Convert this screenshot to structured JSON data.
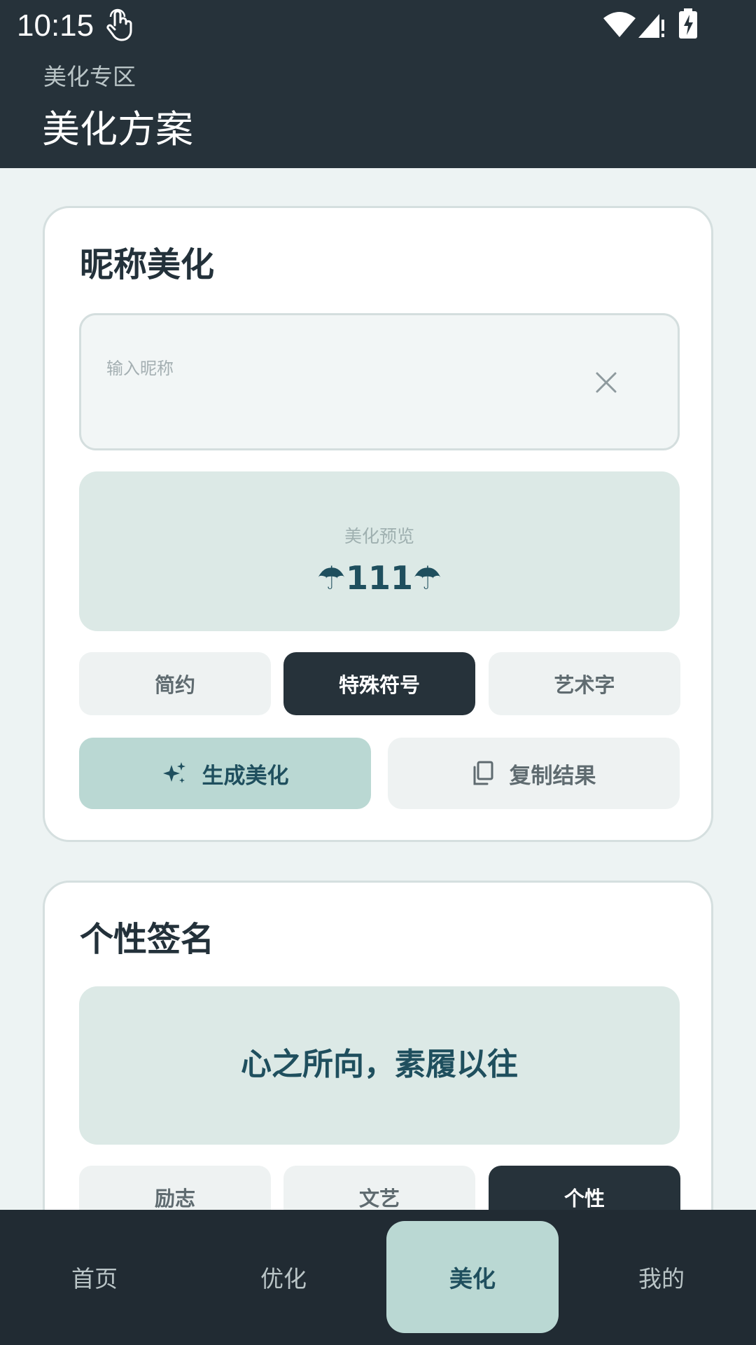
{
  "status_bar": {
    "time": "10:15",
    "icons": [
      "touch-icon",
      "wifi-icon",
      "signal-icon",
      "battery-charging-icon"
    ]
  },
  "header": {
    "subtitle": "美化专区",
    "title": "美化方案"
  },
  "nickname_card": {
    "title": "昵称美化",
    "input": {
      "placeholder": "输入昵称",
      "value": ""
    },
    "preview_label": "美化预览",
    "preview_value": "☂111☂",
    "styles": [
      {
        "label": "简约",
        "active": false
      },
      {
        "label": "特殊符号",
        "active": true
      },
      {
        "label": "艺术字",
        "active": false
      }
    ],
    "generate_label": "生成美化",
    "copy_label": "复制结果"
  },
  "signature_card": {
    "title": "个性签名",
    "signature": "心之所向，素履以往",
    "styles": [
      {
        "label": "励志",
        "active": false
      },
      {
        "label": "文艺",
        "active": false
      },
      {
        "label": "个性",
        "active": true
      }
    ]
  },
  "bottom_nav": {
    "items": [
      {
        "label": "首页",
        "active": false
      },
      {
        "label": "优化",
        "active": false
      },
      {
        "label": "美化",
        "active": true
      },
      {
        "label": "我的",
        "active": false
      }
    ]
  },
  "colors": {
    "header_bg": "#26323a",
    "page_bg": "#edf3f3",
    "accent": "#bad8d3",
    "accent_text": "#1f4f5e",
    "preview_bg": "#dce9e6"
  }
}
